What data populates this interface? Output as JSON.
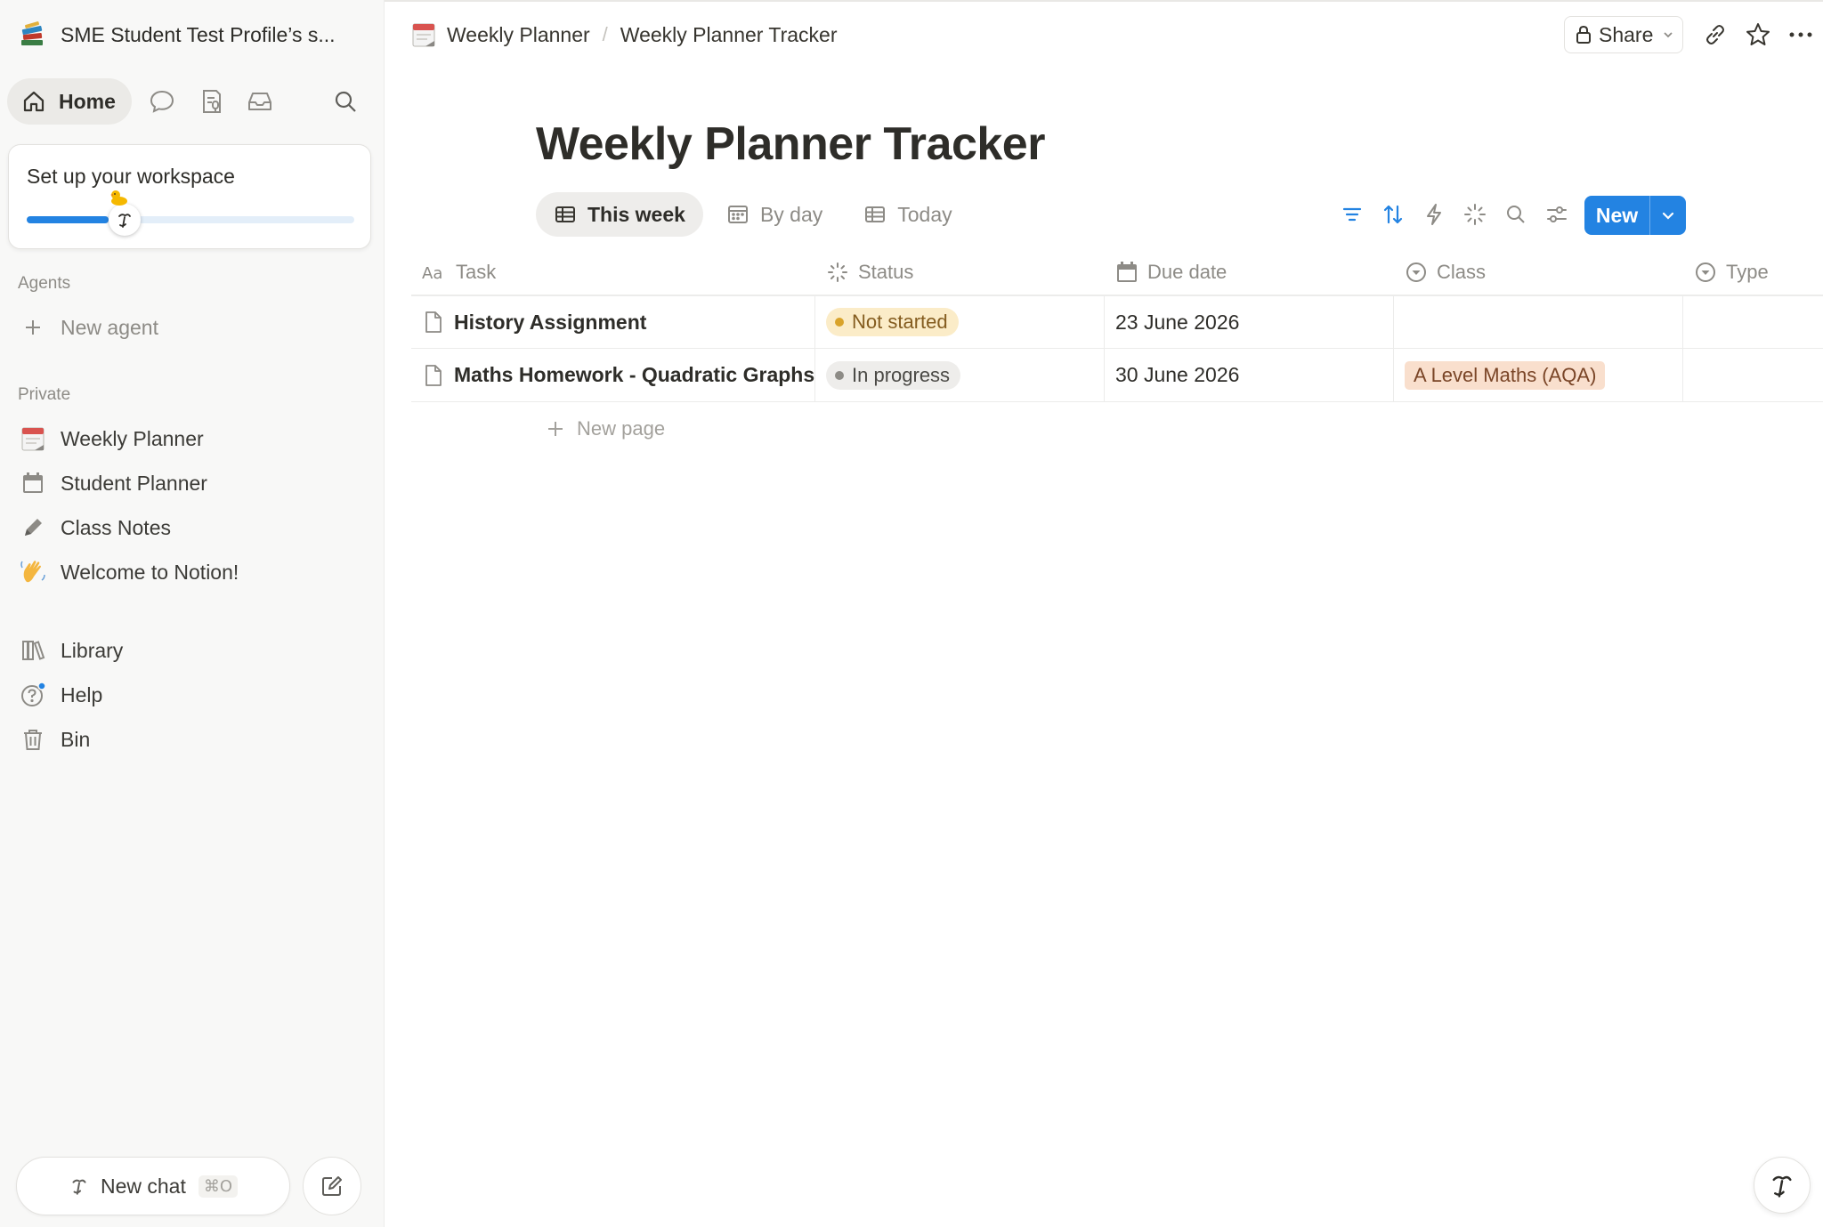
{
  "workspace": {
    "name": "SME Student Test Profile’s s...",
    "icon": "books-stack-icon"
  },
  "topnav": {
    "home_label": "Home"
  },
  "setup": {
    "title": "Set up your workspace",
    "progress": 0.25
  },
  "sidebar": {
    "agents_label": "Agents",
    "new_agent_label": "New agent",
    "private_label": "Private",
    "private_items": [
      {
        "label": "Weekly Planner",
        "icon": "tear-off-calendar-icon"
      },
      {
        "label": "Student Planner",
        "icon": "calendar-icon"
      },
      {
        "label": "Class Notes",
        "icon": "pencil-icon"
      },
      {
        "label": "Welcome to Notion!",
        "icon": "waving-hand-icon"
      }
    ],
    "bottom_items": [
      {
        "label": "Library",
        "icon": "library-icon"
      },
      {
        "label": "Help",
        "icon": "help-icon"
      },
      {
        "label": "Bin",
        "icon": "trash-icon"
      }
    ],
    "new_chat_label": "New chat",
    "new_chat_shortcut": "⌘O"
  },
  "breadcrumb": {
    "parent": "Weekly Planner",
    "current": "Weekly Planner Tracker",
    "separator": "/"
  },
  "topbar": {
    "share_label": "Share"
  },
  "page": {
    "title": "Weekly Planner Tracker"
  },
  "views": [
    {
      "label": "This week",
      "icon": "table-icon",
      "active": true
    },
    {
      "label": "By day",
      "icon": "calendar-icon",
      "active": false
    },
    {
      "label": "Today",
      "icon": "table-icon",
      "active": false
    }
  ],
  "toolbar": {
    "new_label": "New"
  },
  "table": {
    "columns": [
      {
        "label": "Task",
        "icon": "title-aa-icon"
      },
      {
        "label": "Status",
        "icon": "status-spinner-icon"
      },
      {
        "label": "Due date",
        "icon": "calendar-icon"
      },
      {
        "label": "Class",
        "icon": "select-icon"
      },
      {
        "label": "Type",
        "icon": "select-icon"
      }
    ],
    "rows": [
      {
        "task": "History Assignment",
        "status": "Not started",
        "due": "23 June 2026",
        "class": "",
        "type": ""
      },
      {
        "task": "Maths Homework - Quadratic Graphs",
        "status": "In progress",
        "due": "30 June 2026",
        "class": "A Level Maths (AQA)",
        "type": ""
      }
    ],
    "new_page_label": "New page"
  },
  "colors": {
    "accent": "#2383e2",
    "status_not_started_bg": "#fbecc8",
    "status_not_started_dot": "#d9a32a",
    "status_not_started_text": "#845c1f",
    "status_in_progress_bg": "#eeedeb",
    "status_in_progress_dot": "#8d8b86",
    "status_in_progress_text": "#4a4945",
    "class_tag_bg": "#f9dfcd",
    "class_tag_text": "#7a4527"
  }
}
